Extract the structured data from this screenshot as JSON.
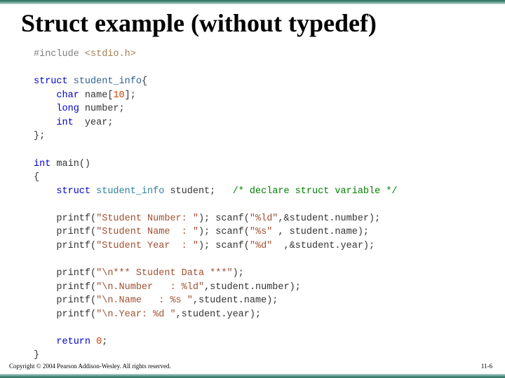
{
  "title": "Struct example (without typedef)",
  "copyright": "Copyright © 2004 Pearson Addison-Wesley. All rights reserved.",
  "pagenum": "11-6",
  "code": {
    "l01_pp": "#include",
    "l01_inc": "<stdio.h>",
    "l03_kw": "struct",
    "l03_id": "student_info",
    "l04_kw": "char",
    "l04_v": "name",
    "l04_n": "10",
    "l05_kw": "long",
    "l05_v": "number",
    "l06_kw": "int",
    "l06_v": "year",
    "l09_kw": "int",
    "l09_fn": "main",
    "l11_kw": "struct",
    "l11_ty": "student_info",
    "l11_v": "student",
    "l11_cmt": "/* declare struct variable */",
    "l13_fn": "printf",
    "l13_s": "\"Student Number: \"",
    "l13_fn2": "scanf",
    "l13_s2": "\"%ld\"",
    "l13_v": "student.number",
    "l14_fn": "printf",
    "l14_s": "\"Student Name  : \"",
    "l14_fn2": "scanf",
    "l14_s2": "\"%s\"",
    "l14_v": "student.name",
    "l15_fn": "printf",
    "l15_s": "\"Student Year  : \"",
    "l15_fn2": "scanf",
    "l15_s2": "\"%d\"",
    "l15_v": "student.year",
    "l17_fn": "printf",
    "l17_s": "\"\\n*** Student Data ***\"",
    "l18_fn": "printf",
    "l18_s": "\"\\n.Number   : %ld\"",
    "l18_v": "student.number",
    "l19_fn": "printf",
    "l19_s": "\"\\n.Name   : %s \"",
    "l19_v": "student.name",
    "l20_fn": "printf",
    "l20_s": "\"\\n.Year: %d \"",
    "l20_v": "student.year",
    "l22_kw": "return",
    "l22_n": "0"
  }
}
